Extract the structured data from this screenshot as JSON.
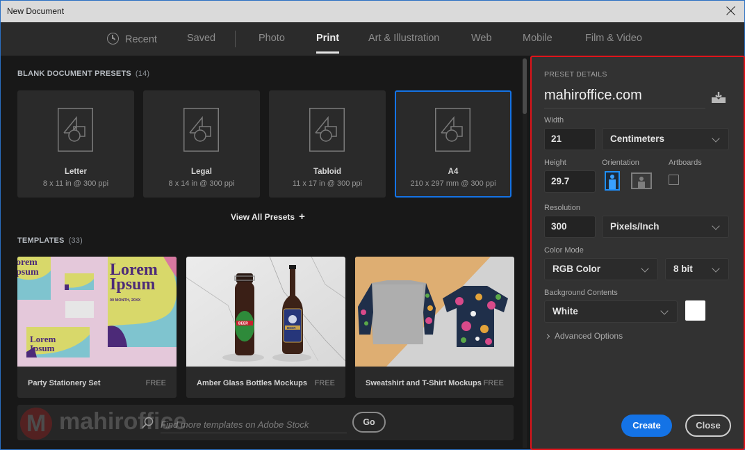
{
  "window": {
    "title": "New Document"
  },
  "tabs": [
    {
      "label": "Recent",
      "icon": "clock-icon",
      "active": false
    },
    {
      "label": "Saved",
      "active": false
    },
    {
      "label": "Photo",
      "active": false
    },
    {
      "label": "Print",
      "active": true
    },
    {
      "label": "Art & Illustration",
      "active": false
    },
    {
      "label": "Web",
      "active": false
    },
    {
      "label": "Mobile",
      "active": false
    },
    {
      "label": "Film & Video",
      "active": false
    }
  ],
  "presets_section": {
    "title": "BLANK DOCUMENT PRESETS",
    "count": "(14)",
    "items": [
      {
        "name": "Letter",
        "dims": "8 x 11 in @ 300 ppi",
        "selected": false
      },
      {
        "name": "Legal",
        "dims": "8 x 14 in @ 300 ppi",
        "selected": false
      },
      {
        "name": "Tabloid",
        "dims": "11 x 17 in @ 300 ppi",
        "selected": false
      },
      {
        "name": "A4",
        "dims": "210 x 297 mm @ 300 ppi",
        "selected": true
      }
    ],
    "view_all_label": "View All Presets",
    "view_all_icon": "plus-icon"
  },
  "templates_section": {
    "title": "TEMPLATES",
    "count": "(33)",
    "items": [
      {
        "name": "Party Stationery Set",
        "price": "FREE",
        "thumb_text_1": "Lorem",
        "thumb_text_2": "Ipsum",
        "thumb_date": "00 MONTH, 20XX"
      },
      {
        "name": "Amber Glass Bottles Mockups",
        "price": "FREE",
        "label_1": "BEER",
        "label_2": "BEER"
      },
      {
        "name": "Sweatshirt and T-Shirt Mockups",
        "price": "FREE"
      }
    ]
  },
  "stock_search": {
    "placeholder": "Find more templates on Adobe Stock",
    "value": "",
    "go_label": "Go"
  },
  "watermark": {
    "letter": "M",
    "text": "mahiroffice"
  },
  "preset_details": {
    "header": "PRESET DETAILS",
    "document_name": "mahiroffice.com",
    "width_label": "Width",
    "width_value": "21",
    "width_unit": "Centimeters",
    "height_label": "Height",
    "height_value": "29.7",
    "orientation_label": "Orientation",
    "orientation": "portrait",
    "artboards_label": "Artboards",
    "artboards_checked": false,
    "resolution_label": "Resolution",
    "resolution_value": "300",
    "resolution_unit": "Pixels/Inch",
    "color_mode_label": "Color Mode",
    "color_mode": "RGB Color",
    "bit_depth": "8 bit",
    "background_label": "Background Contents",
    "background": "White",
    "background_color": "#ffffff",
    "advanced_label": "Advanced Options",
    "create_label": "Create",
    "close_label": "Close"
  },
  "colors": {
    "accent": "#1473e6",
    "highlight_border": "#e0141a",
    "panel_bg": "#323232",
    "content_bg": "#181818"
  }
}
